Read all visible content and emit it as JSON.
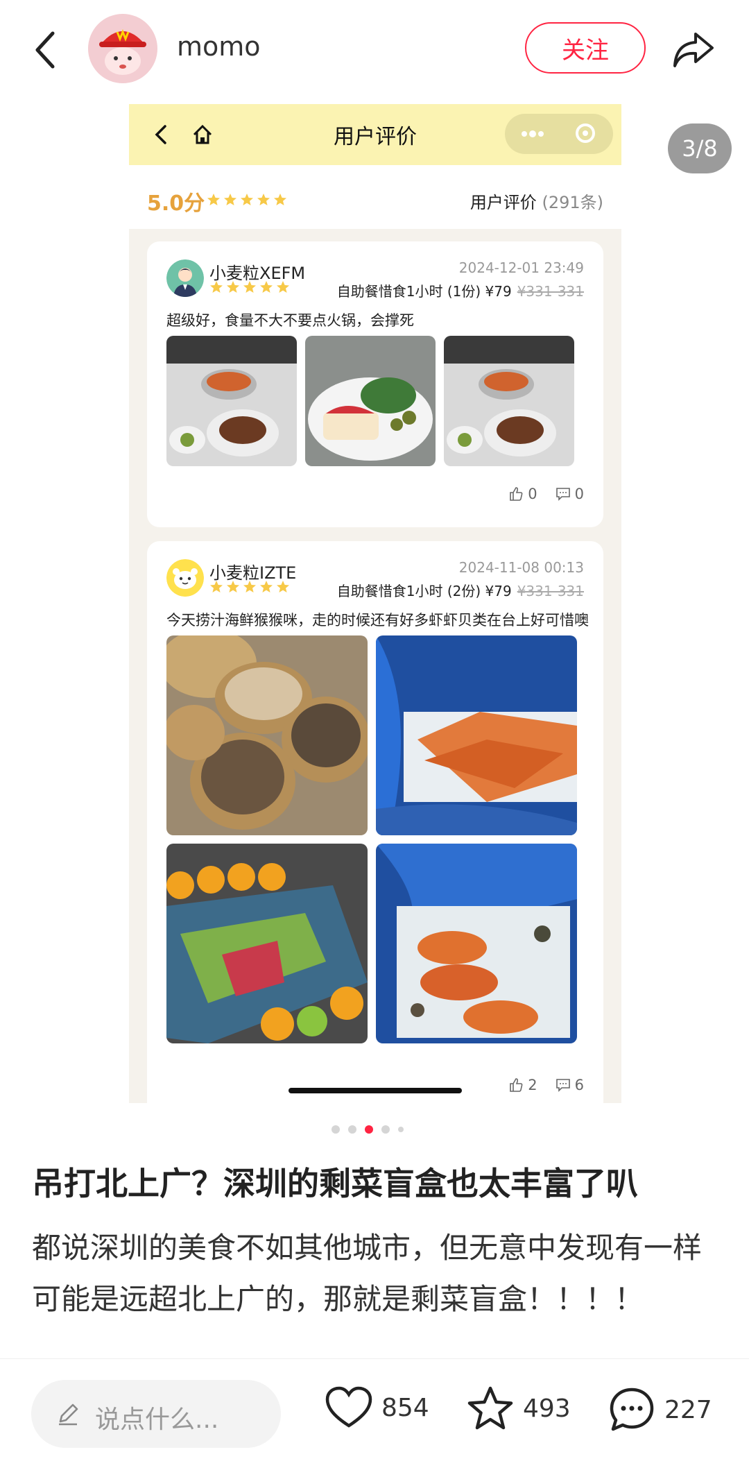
{
  "header": {
    "username": "momo",
    "follow_label": "关注"
  },
  "page_indicator": "3/8",
  "screenshot": {
    "nav_title": "用户评价",
    "score": "5.0分",
    "review_title": "用户评价",
    "review_count": "(291条)",
    "reviews": [
      {
        "name": "小麦粒XEFM",
        "date": "2024-12-01 23:49",
        "product": "自助餐惜食1小时 (1份) ¥79",
        "original_price": "¥331-331",
        "text": "超级好，食量不大不要点火锅，会撑死",
        "likes": "0",
        "comments": "0"
      },
      {
        "name": "小麦粒IZTE",
        "date": "2024-11-08 00:13",
        "product": "自助餐惜食1小时 (2份) ¥79",
        "original_price": "¥331-331",
        "text": "今天捞汁海鲜猴猴咪，走的时候还有好多虾虾贝类在台上好可惜噢",
        "likes": "2",
        "comments": "6"
      }
    ]
  },
  "post": {
    "title": "吊打北上广？深圳的剩菜盲盒也太丰富了叭",
    "body": "都说深圳的美食不如其他城市，但无意中发现有一样可能是远超北上广的，那就是剩菜盲盒！！！！"
  },
  "bottom_bar": {
    "comment_placeholder": "说点什么...",
    "likes": "854",
    "stars": "493",
    "comments": "227"
  },
  "colors": {
    "accent": "#ff2442",
    "mini_nav_bg": "#fbf3b2",
    "score_gold": "#e6a23c"
  }
}
